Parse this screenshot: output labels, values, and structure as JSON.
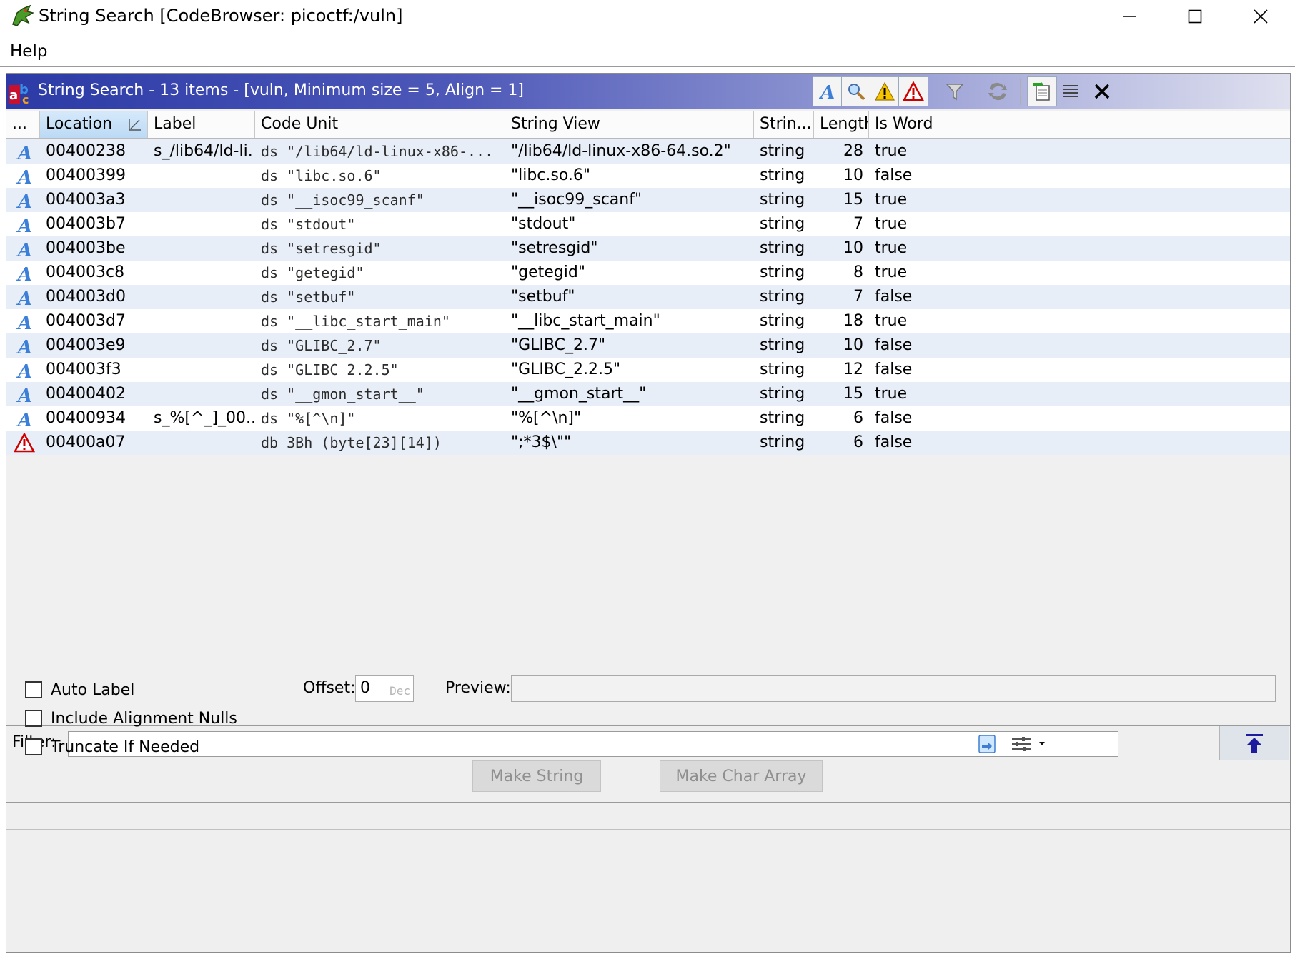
{
  "window": {
    "title": "String Search [CodeBrowser: picoctf:/vuln]"
  },
  "menu": {
    "help": "Help"
  },
  "panel": {
    "title": "String Search - 13 items - [vuln, Minimum size = 5, Align = 1]"
  },
  "columns": {
    "more": "...",
    "location": "Location",
    "label": "Label",
    "code_unit": "Code Unit",
    "string_view": "String View",
    "string_type": "Strin...",
    "length": "Length",
    "is_word": "Is Word"
  },
  "rows": [
    {
      "icon": "string-icon",
      "location": "00400238",
      "label": "s_/lib64/ld-li...",
      "code_unit": "ds \"/lib64/ld-linux-x86-...",
      "string_view": "\"/lib64/ld-linux-x86-64.so.2\"",
      "type": "string",
      "length": "28",
      "is_word": "true"
    },
    {
      "icon": "string-icon",
      "location": "00400399",
      "label": "",
      "code_unit": "ds \"libc.so.6\"",
      "string_view": "\"libc.so.6\"",
      "type": "string",
      "length": "10",
      "is_word": "false"
    },
    {
      "icon": "string-icon",
      "location": "004003a3",
      "label": "",
      "code_unit": "ds \"__isoc99_scanf\"",
      "string_view": "\"__isoc99_scanf\"",
      "type": "string",
      "length": "15",
      "is_word": "true"
    },
    {
      "icon": "string-icon",
      "location": "004003b7",
      "label": "",
      "code_unit": "ds \"stdout\"",
      "string_view": "\"stdout\"",
      "type": "string",
      "length": "7",
      "is_word": "true"
    },
    {
      "icon": "string-icon",
      "location": "004003be",
      "label": "",
      "code_unit": "ds \"setresgid\"",
      "string_view": "\"setresgid\"",
      "type": "string",
      "length": "10",
      "is_word": "true"
    },
    {
      "icon": "string-icon",
      "location": "004003c8",
      "label": "",
      "code_unit": "ds \"getegid\"",
      "string_view": "\"getegid\"",
      "type": "string",
      "length": "8",
      "is_word": "true"
    },
    {
      "icon": "string-icon",
      "location": "004003d0",
      "label": "",
      "code_unit": "ds \"setbuf\"",
      "string_view": "\"setbuf\"",
      "type": "string",
      "length": "7",
      "is_word": "false"
    },
    {
      "icon": "string-icon",
      "location": "004003d7",
      "label": "",
      "code_unit": "ds \"__libc_start_main\"",
      "string_view": "\"__libc_start_main\"",
      "type": "string",
      "length": "18",
      "is_word": "true"
    },
    {
      "icon": "string-icon",
      "location": "004003e9",
      "label": "",
      "code_unit": "ds \"GLIBC_2.7\"",
      "string_view": "\"GLIBC_2.7\"",
      "type": "string",
      "length": "10",
      "is_word": "false"
    },
    {
      "icon": "string-icon",
      "location": "004003f3",
      "label": "",
      "code_unit": "ds \"GLIBC_2.2.5\"",
      "string_view": "\"GLIBC_2.2.5\"",
      "type": "string",
      "length": "12",
      "is_word": "false"
    },
    {
      "icon": "string-icon",
      "location": "00400402",
      "label": "",
      "code_unit": "ds \"__gmon_start__\"",
      "string_view": "\"__gmon_start__\"",
      "type": "string",
      "length": "15",
      "is_word": "true"
    },
    {
      "icon": "string-icon",
      "location": "00400934",
      "label": "s_%[^_]_00...",
      "code_unit": "ds \"%[^\\n]\"",
      "string_view": "\"%[^\\n]\"",
      "type": "string",
      "length": "6",
      "is_word": "false"
    },
    {
      "icon": "conflict-warning-icon",
      "location": "00400a07",
      "label": "",
      "code_unit": "db 3Bh (byte[23][14])",
      "string_view": "\";*3$\\\"\"",
      "type": "string",
      "length": "6",
      "is_word": "false"
    }
  ],
  "filter": {
    "label": "Filter:",
    "value": ""
  },
  "options": {
    "auto_label": "Auto Label",
    "include_alignment_nulls": "Include Alignment Nulls",
    "truncate_if_needed": "Truncate If Needed",
    "offset_label": "Offset:",
    "offset_value": "0",
    "offset_hint": "Dec",
    "preview_label": "Preview:",
    "preview_value": ""
  },
  "buttons": {
    "make_string": "Make String",
    "make_char_array": "Make Char Array"
  },
  "colors": {
    "header_gradient_start": "#2b3aa6",
    "alt_row": "#e8eef8",
    "sorted_header": "#bcdaf5"
  }
}
